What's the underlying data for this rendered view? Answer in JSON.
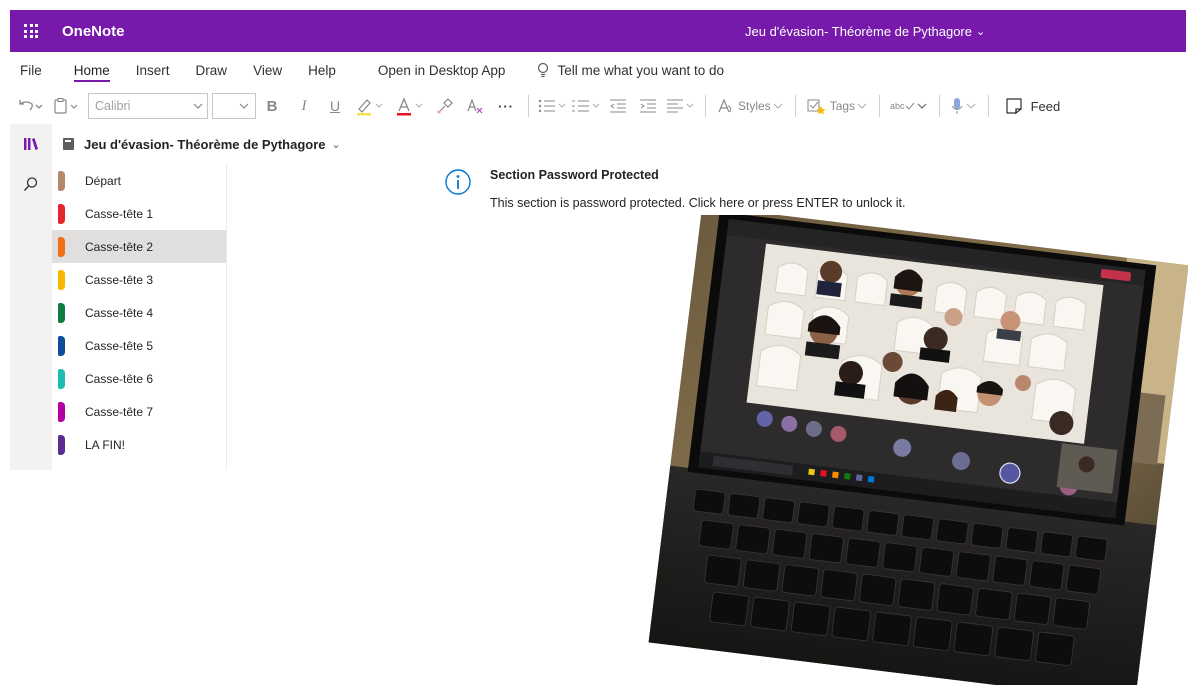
{
  "titlebar": {
    "app_name": "OneNote",
    "doc_title": "Jeu d'évasion- Théorème de Pythagore",
    "chevron": "⌄"
  },
  "menu": {
    "items": [
      "File",
      "Home",
      "Insert",
      "Draw",
      "View",
      "Help"
    ],
    "active": "Home",
    "open_desktop": "Open in Desktop App",
    "tell_me": "Tell me what you want to do"
  },
  "ribbon": {
    "font_name": "Calibri",
    "bold": "B",
    "italic": "I",
    "underline": "U",
    "more": "···",
    "styles": "Styles",
    "tags": "Tags",
    "feed": "Feed",
    "spell": "abc"
  },
  "notebook": {
    "title": "Jeu d'évasion- Théorème de Pythagore",
    "sections": [
      {
        "label": "Départ",
        "color": "#b4886b"
      },
      {
        "label": "Casse-tête 1",
        "color": "#e3262b"
      },
      {
        "label": "Casse-tête 2",
        "color": "#f07018",
        "selected": true
      },
      {
        "label": "Casse-tête 3",
        "color": "#f9b800"
      },
      {
        "label": "Casse-tête 4",
        "color": "#107c41"
      },
      {
        "label": "Casse-tête 5",
        "color": "#0f4c9c"
      },
      {
        "label": "Casse-tête 6",
        "color": "#1dbdb1"
      },
      {
        "label": "Casse-tête 7",
        "color": "#b4009e"
      },
      {
        "label": "LA FIN!",
        "color": "#5c2d91"
      }
    ]
  },
  "message": {
    "title": "Section Password Protected",
    "text": "This section is password protected. Click here or press ENTER to unlock it."
  },
  "colors": {
    "brand": "#7719aa",
    "info": "#0078d4"
  },
  "photo": {
    "description_icon": "laptop-video-call-photo",
    "taskbar_search": "Type here to search",
    "call_action": "Leave",
    "participants": [
      "GB",
      "FS",
      "CK",
      "CM",
      "LC",
      "MD",
      "KN",
      "EH"
    ]
  }
}
